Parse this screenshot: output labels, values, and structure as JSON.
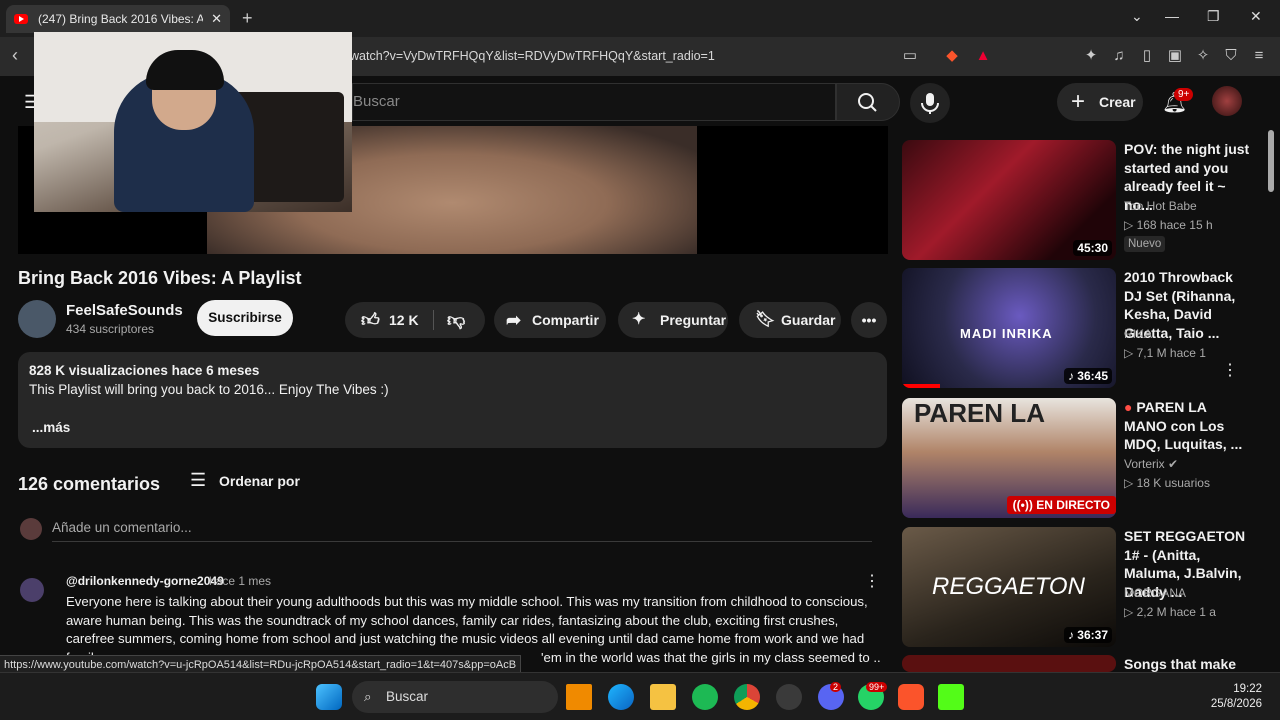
{
  "browser": {
    "tab_title": "(247) Bring Back 2016 Vibes: A Pl",
    "url": "watch?v=VyDwTRFHQqY&list=RDVyDwTRFHQqY&start_radio=1",
    "status_url": "https://www.youtube.com/watch?v=u-jcRpOA514&list=RDu-jcRpOA514&start_radio=1&t=407s&pp=oAcB"
  },
  "header": {
    "search_placeholder": "Buscar",
    "create_label": "Crear",
    "notif_badge": "9+"
  },
  "video": {
    "title": "Bring Back 2016 Vibes: A Playlist",
    "channel": "FeelSafeSounds",
    "subscribers": "434 suscriptores",
    "subscribe_label": "Suscribirse",
    "likes": "12 K",
    "share_label": "Compartir",
    "ask_label": "Preguntar",
    "save_label": "Guardar",
    "desc_meta": "828 K visualizaciones  hace 6 meses",
    "desc_text": "This Playlist will bring you back to 2016... Enjoy The Vibes :)",
    "desc_more": "...más"
  },
  "comments": {
    "count_label": "126 comentarios",
    "sort_label": "Ordenar por",
    "add_placeholder": "Añade un comentario...",
    "items": [
      {
        "author": "@drilonkennedy-gorne2049",
        "time": "hace 1 mes",
        "text": "Everyone here is talking about their young adulthoods but this was my middle school. This was my transition from childhood to conscious, aware human being. This was the soundtrack of my school dances, family car rides, fantasizing about the club, exciting first crushes, carefree summers, coming home from school and just watching the music videos all evening until dad came home from work and we had family"
      }
    ],
    "partial_tail": "'em in the world was that the girls in my class seemed to .."
  },
  "recommendations": [
    {
      "title": "POV: the night just started and you already feel it ~ no...",
      "channel": "Too Hot Babe",
      "stats": "▷ 168  hace 15 h",
      "badge": "Nuevo",
      "duration": "45:30"
    },
    {
      "title": "2010 Throwback DJ Set (Rihanna, Kesha, David Guetta, Taio ...",
      "channel": "RIKA",
      "stats": "▷ 7,1 M  hace 1",
      "duration": "36:45",
      "thumb_text": "MADI INRIKA"
    },
    {
      "title": "PAREN LA MANO con Los MDQ, Luquitas, ...",
      "channel": "Vorterix",
      "stats": "▷ 18 K usuarios",
      "live_label": "EN DIRECTO",
      "thumb_text": "PAREN LA"
    },
    {
      "title": "SET REGGAETON 1# - (Anitta, Maluma, J.Balvin, Daddy ...",
      "channel": "MORGANA",
      "stats": "▷ 2,2 M  hace 1 a",
      "duration": "36:37",
      "thumb_text": "REGGAETON"
    },
    {
      "title": "Songs that make"
    }
  ],
  "taskbar": {
    "search_label": "Buscar",
    "time": "19:22",
    "date": "25/8/2026",
    "whatsapp_badge": "99+",
    "discord_badge": "2"
  },
  "colors": {
    "background": "#0f0f0f",
    "accent_red": "#ff0000",
    "live_red": "#cc0000"
  }
}
